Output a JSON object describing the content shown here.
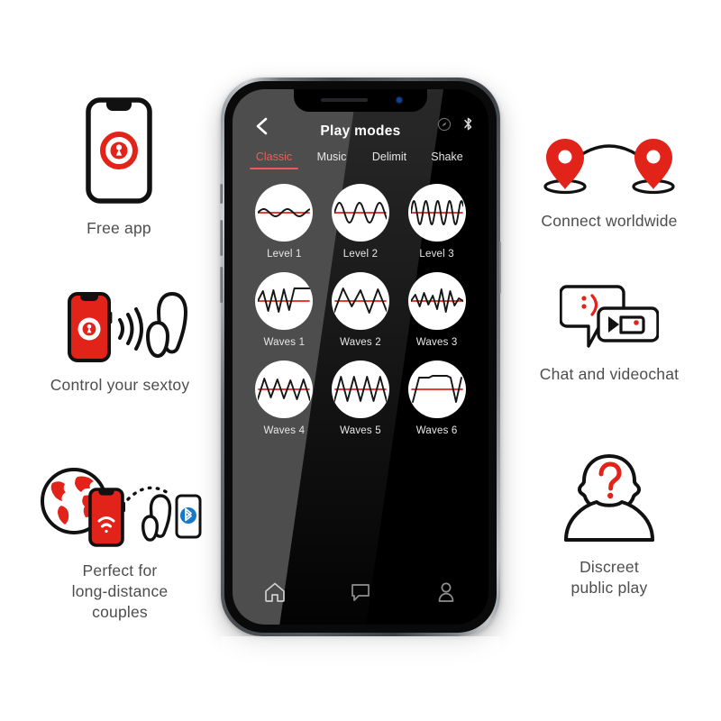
{
  "accent": {
    "red": "#e2231a",
    "soft_red": "#ef5b5b",
    "blue": "#1878c8",
    "caption_gray": "#4d4d4d"
  },
  "features_left": [
    {
      "id": "free-app",
      "icon": "phone-with-lock-logo-icon",
      "caption": "Free app"
    },
    {
      "id": "control-sextoy",
      "icon": "phone-signal-toy-icon",
      "caption": "Control your sextoy"
    },
    {
      "id": "long-distance",
      "icon": "globe-phone-bluetooth-toy-icon",
      "caption": "Perfect for\nlong-distance\ncouples"
    }
  ],
  "features_right": [
    {
      "id": "connect-worldwide",
      "icon": "two-map-pins-arc-icon",
      "caption": "Connect worldwide"
    },
    {
      "id": "chat-videochat",
      "icon": "speech-bubbles-video-icon",
      "caption": "Chat and videochat"
    },
    {
      "id": "discreet-play",
      "icon": "anonymous-person-question-icon",
      "caption": "Discreet\npublic play"
    }
  ],
  "phone": {
    "header": {
      "back_icon": "chevron-left-icon",
      "title": "Play modes",
      "icons": [
        "compass-icon",
        "bluetooth-icon"
      ]
    },
    "tabs": [
      {
        "label": "Classic",
        "active": true
      },
      {
        "label": "Music",
        "active": false
      },
      {
        "label": "Delimit",
        "active": false
      },
      {
        "label": "Shake",
        "active": false
      }
    ],
    "modes": [
      {
        "label": "Level 1",
        "wave": "low-amplitude-sine"
      },
      {
        "label": "Level 2",
        "wave": "medium-amplitude-sine"
      },
      {
        "label": "Level 3",
        "wave": "high-frequency-sine"
      },
      {
        "label": "Waves 1",
        "wave": "spike-then-plateau"
      },
      {
        "label": "Waves 2",
        "wave": "wide-zigzag"
      },
      {
        "label": "Waves 3",
        "wave": "dense-irregular-zigzag"
      },
      {
        "label": "Waves 4",
        "wave": "descending-zigzag"
      },
      {
        "label": "Waves 5",
        "wave": "triangle-saw"
      },
      {
        "label": "Waves 6",
        "wave": "square-pulse"
      }
    ],
    "bottom_nav": [
      {
        "id": "home",
        "icon": "home-icon"
      },
      {
        "id": "chat",
        "icon": "chat-bubble-icon"
      },
      {
        "id": "profile",
        "icon": "person-icon"
      }
    ]
  }
}
